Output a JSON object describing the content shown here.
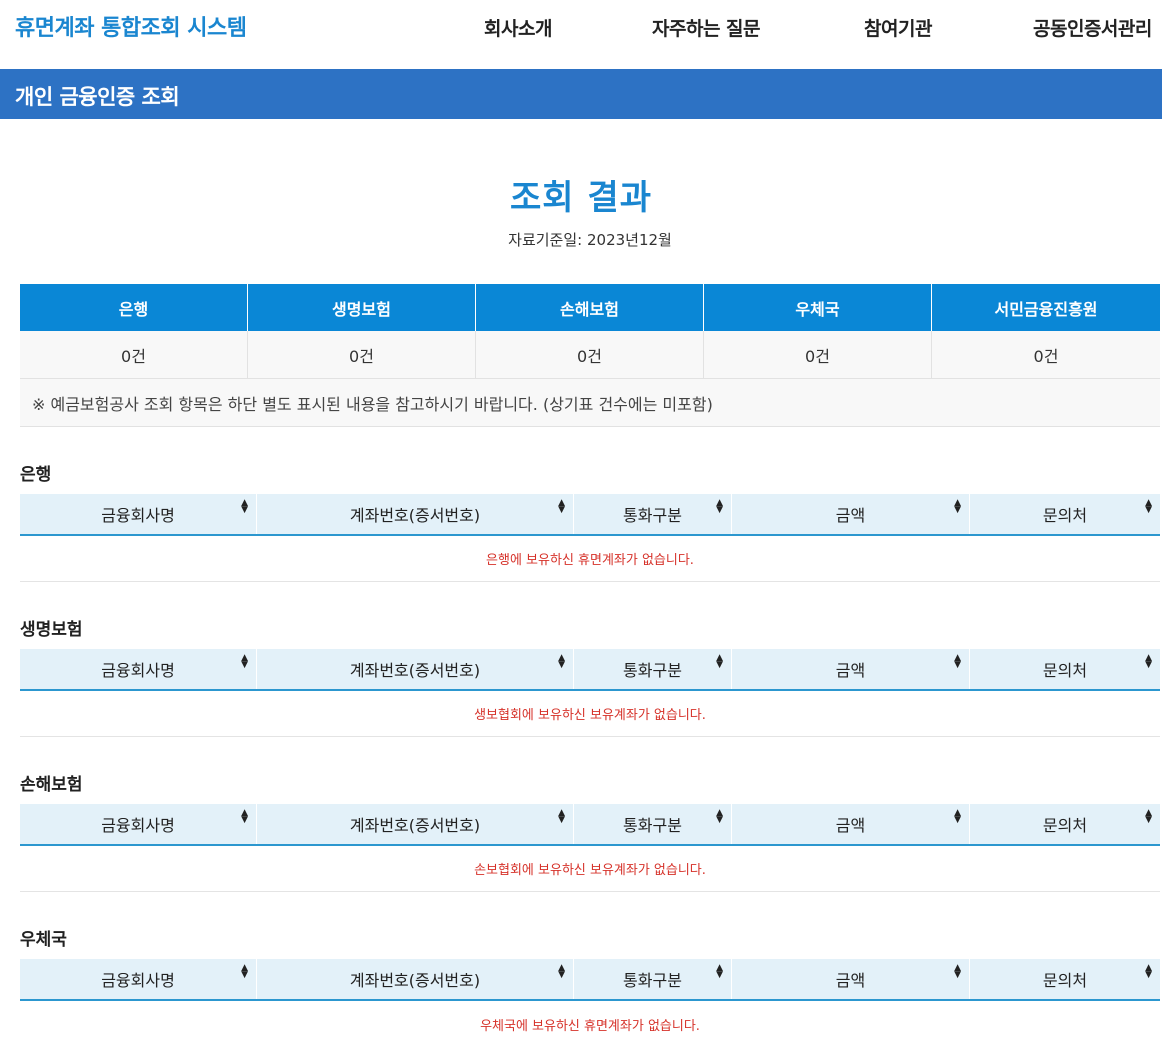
{
  "header": {
    "logo": "휴면계좌 통합조회 시스템",
    "nav": [
      "회사소개",
      "자주하는 질문",
      "참여기관",
      "공동인증서관리"
    ]
  },
  "page_title": "개인 금융인증 조회",
  "result": {
    "title": "조회 결과",
    "basis": "자료기준일:  2023년12월"
  },
  "summary": {
    "headers": [
      "은행",
      "생명보험",
      "손해보험",
      "우체국",
      "서민금융진흥원"
    ],
    "counts": [
      "0건",
      "0건",
      "0건",
      "0건",
      "0건"
    ],
    "note": "※ 예금보험공사 조회 항목은 하단 별도 표시된 내용을 참고하시기 바랍니다. (상기표 건수에는 미포함)"
  },
  "table_columns": [
    "금융회사명",
    "계좌번호(증서번호)",
    "통화구분",
    "금액",
    "문의처"
  ],
  "sections": [
    {
      "title": "은행",
      "empty_message": "은행에 보유하신 휴면계좌가 없습니다."
    },
    {
      "title": "생명보험",
      "empty_message": "생보협회에 보유하신 보유계좌가 없습니다."
    },
    {
      "title": "손해보험",
      "empty_message": "손보협회에 보유하신 보유계좌가 없습니다."
    },
    {
      "title": "우체국",
      "empty_message": "우체국에 보유하신 휴면계좌가 없습니다."
    }
  ],
  "colors": {
    "brand": "#1a86d0",
    "page_bar": "#2d72c4",
    "summary_header": "#0a87d6",
    "empty_text": "#d6322a"
  }
}
